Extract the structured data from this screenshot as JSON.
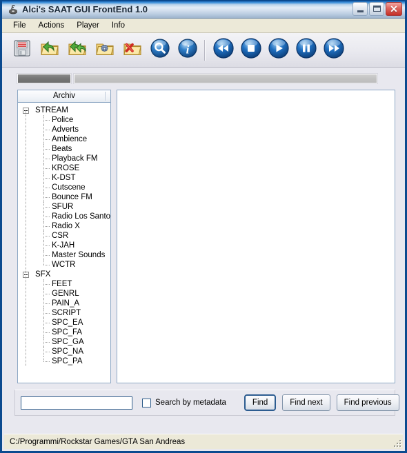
{
  "window": {
    "title": "Alci's SAAT GUI FrontEnd 1.0",
    "icon": "audio-disc-icon",
    "controls": {
      "minimize": "minimize-icon",
      "maximize": "maximize-icon",
      "close_glyph": "✕"
    },
    "accent_color": "#0b4a8f",
    "titlebar_face": "#bcd4ea"
  },
  "menubar": {
    "items": [
      {
        "label": "File"
      },
      {
        "label": "Actions"
      },
      {
        "label": "Player"
      },
      {
        "label": "Info"
      }
    ]
  },
  "toolbar": {
    "buttons": [
      {
        "icon": "save-floppy-icon",
        "group": "file"
      },
      {
        "icon": "open-folder-import-icon",
        "group": "file"
      },
      {
        "icon": "open-folder-export-icon",
        "group": "file"
      },
      {
        "icon": "folder-settings-icon",
        "group": "file"
      },
      {
        "icon": "folder-delete-icon",
        "group": "file"
      },
      {
        "icon": "search-icon",
        "group": "file"
      },
      {
        "icon": "info-icon",
        "group": "file"
      },
      {
        "icon": "rewind-icon",
        "group": "player"
      },
      {
        "icon": "stop-icon",
        "group": "player"
      },
      {
        "icon": "play-icon",
        "group": "player"
      },
      {
        "icon": "pause-icon",
        "group": "player"
      },
      {
        "icon": "fast-forward-icon",
        "group": "player"
      }
    ],
    "separator_after_index": 6
  },
  "progress": {
    "bars": [
      {
        "name": "file-progress",
        "value": 0,
        "fill_color": "#757575"
      },
      {
        "name": "total-progress",
        "value": 0,
        "fill_color": "#c2c2c2"
      }
    ]
  },
  "tree": {
    "header": "Archiv",
    "groups": [
      {
        "label": "STREAM",
        "expanded": true,
        "children": [
          "Police",
          "Adverts",
          "Ambience",
          "Beats",
          "Playback FM",
          "KROSE",
          "K-DST",
          "Cutscene",
          "Bounce FM",
          "SFUR",
          "Radio Los Santos",
          "Radio X",
          "CSR",
          "K-JAH",
          "Master Sounds",
          "WCTR"
        ]
      },
      {
        "label": "SFX",
        "expanded": true,
        "children": [
          "FEET",
          "GENRL",
          "PAIN_A",
          "SCRIPT",
          "SPC_EA",
          "SPC_FA",
          "SPC_GA",
          "SPC_NA",
          "SPC_PA"
        ]
      }
    ]
  },
  "content": {
    "items": []
  },
  "search": {
    "value": "",
    "placeholder": "",
    "metadata_label": "Search by metadata",
    "metadata_checked": false,
    "buttons": [
      {
        "label": "Find",
        "default": true
      },
      {
        "label": "Find next",
        "default": false
      },
      {
        "label": "Find previous",
        "default": false
      }
    ]
  },
  "statusbar": {
    "path": "C:/Programmi/Rockstar Games/GTA San Andreas"
  }
}
